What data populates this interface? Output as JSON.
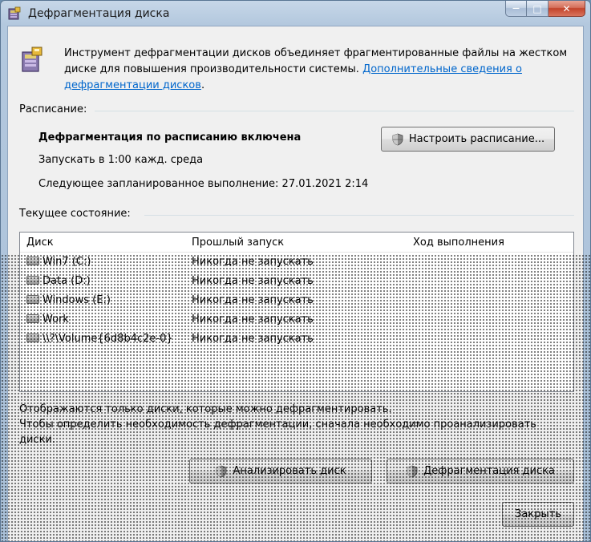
{
  "window": {
    "title": "Дефрагментация диска",
    "min_glyph": "—",
    "max_glyph": "□",
    "close_glyph": "✕"
  },
  "description": {
    "text": "Инструмент дефрагментации дисков объединяет фрагментированные файлы на жестком диске для повышения производительности системы. ",
    "link": "Дополнительные сведения о дефрагментации дисков",
    "tail": "."
  },
  "schedule": {
    "section_label": "Расписание:",
    "status": "Дефрагментация по расписанию включена",
    "run_text": "Запускать в 1:00 кажд. среда",
    "next_text": "Следующее запланированное выполнение: 27.01.2021 2:14",
    "configure_button": "Настроить расписание..."
  },
  "current_state": {
    "section_label": "Текущее состояние:",
    "columns": [
      "Диск",
      "Прошлый запуск",
      "Ход выполнения"
    ],
    "rows": [
      {
        "disk": "Win7 (C:)",
        "last_run": "Никогда не запускать"
      },
      {
        "disk": "Data (D:)",
        "last_run": "Никогда не запускать"
      },
      {
        "disk": "Windows (E:)",
        "last_run": "Никогда не запускать"
      },
      {
        "disk": "Work",
        "last_run": "Никогда не запускать"
      },
      {
        "disk": "\\\\?\\Volume{6d8b4c2e-0}",
        "last_run": "Никогда не запускать"
      }
    ]
  },
  "note": {
    "line1": "Отображаются только диски, которые можно дефрагментировать.",
    "line2": "Чтобы определить необходимость дефрагментации, сначала необходимо проанализировать диски."
  },
  "buttons": {
    "analyze": "Анализировать диск",
    "defrag": "Дефрагментация диска",
    "close": "Закрыть"
  }
}
